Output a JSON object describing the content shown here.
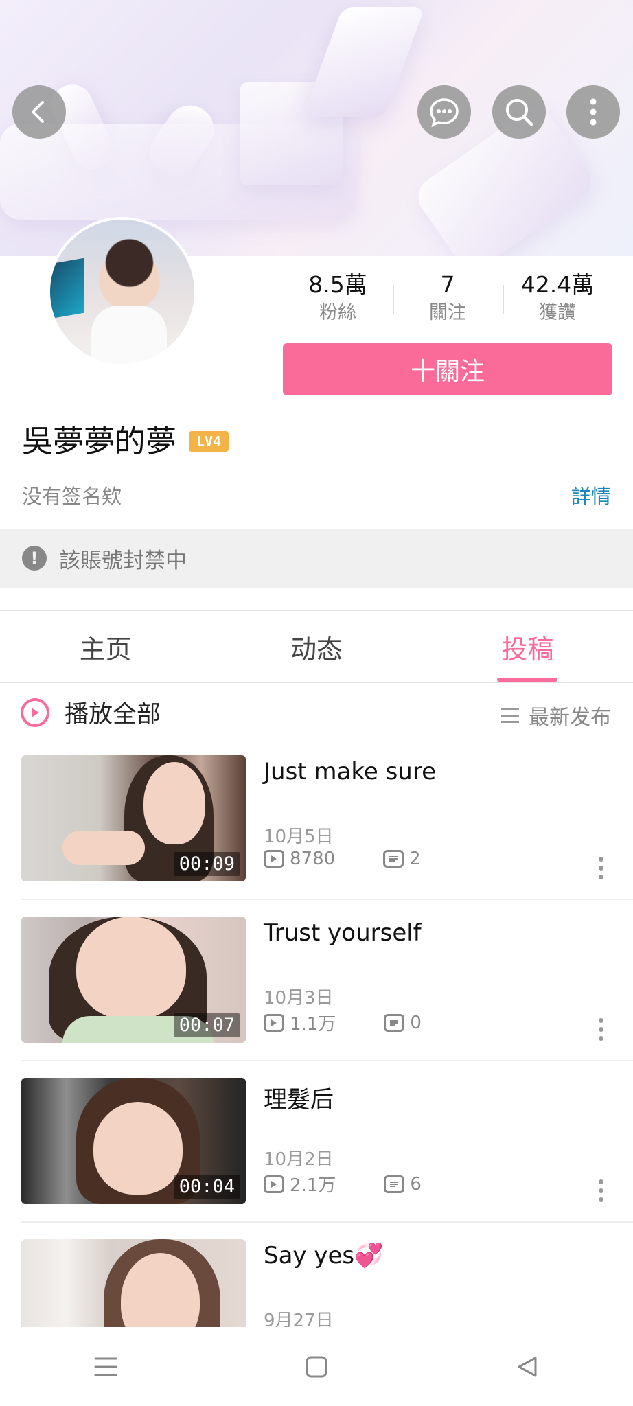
{
  "header": {
    "back_icon": "chevron-left-icon",
    "chat_icon": "chat-bubble-icon",
    "search_icon": "search-icon",
    "more_icon": "more-vertical-icon"
  },
  "profile": {
    "stats": [
      {
        "value": "8.5萬",
        "label": "粉絲"
      },
      {
        "value": "7",
        "label": "關注"
      },
      {
        "value": "42.4萬",
        "label": "獲讚"
      }
    ],
    "follow_label": "十關注",
    "name": "吳夢夢的夢",
    "level_badge": "LV4",
    "signature": "没有签名欸",
    "detail_link": "詳情",
    "banned_notice": "該賬號封禁中",
    "accent_color": "#fb6b9a"
  },
  "tabs": [
    {
      "label": "主页"
    },
    {
      "label": "动态"
    },
    {
      "label": "投稿",
      "active": true
    }
  ],
  "toolbar": {
    "play_all": "播放全部",
    "sort_label": "最新发布"
  },
  "videos": [
    {
      "title": "Just make sure",
      "duration": "00:09",
      "date": "10月5日",
      "views": "8780",
      "comments": "2"
    },
    {
      "title": "Trust yourself",
      "duration": "00:07",
      "date": "10月3日",
      "views": "1.1万",
      "comments": "0"
    },
    {
      "title": "理髮后",
      "duration": "00:04",
      "date": "10月2日",
      "views": "2.1万",
      "comments": "6"
    },
    {
      "title": "Say yes💞",
      "duration": "",
      "date": "9月27日",
      "views": "",
      "comments": ""
    }
  ],
  "system_nav": {
    "menu_icon": "menu-icon",
    "home_icon": "home-square-icon",
    "back_icon": "back-triangle-icon"
  }
}
